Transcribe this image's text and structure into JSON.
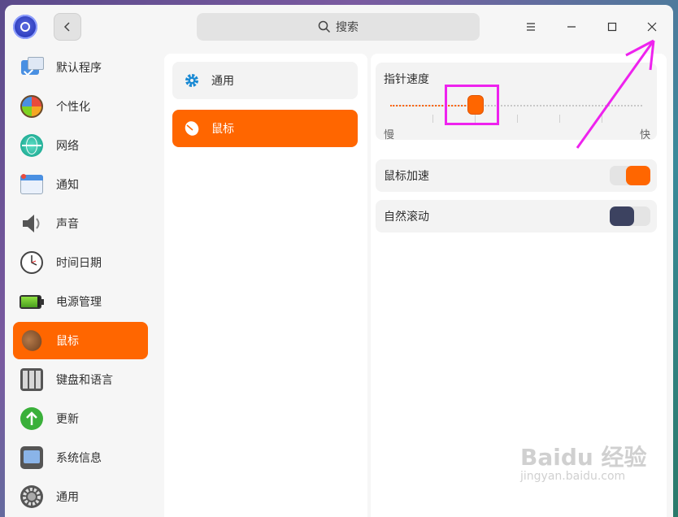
{
  "search": {
    "label": "搜索"
  },
  "titlebar": {
    "menu_icon": "menu-icon",
    "minimize_icon": "minimize-icon",
    "maximize_icon": "maximize-icon",
    "close_icon": "close-icon"
  },
  "sidebar": {
    "items": [
      {
        "label": "默认程序",
        "icon": "default-apps-icon"
      },
      {
        "label": "个性化",
        "icon": "personalization-icon"
      },
      {
        "label": "网络",
        "icon": "network-icon"
      },
      {
        "label": "通知",
        "icon": "notification-icon"
      },
      {
        "label": "声音",
        "icon": "sound-icon"
      },
      {
        "label": "时间日期",
        "icon": "clock-icon"
      },
      {
        "label": "电源管理",
        "icon": "battery-icon"
      },
      {
        "label": "鼠标",
        "icon": "mouse-icon",
        "active": true
      },
      {
        "label": "键盘和语言",
        "icon": "keyboard-icon"
      },
      {
        "label": "更新",
        "icon": "update-icon"
      },
      {
        "label": "系统信息",
        "icon": "system-info-icon"
      },
      {
        "label": "通用",
        "icon": "general-icon"
      }
    ]
  },
  "submenu": {
    "general": "通用",
    "mouse": "鼠标"
  },
  "mouse_settings": {
    "pointer_speed": {
      "label": "指针速度",
      "slow": "慢",
      "fast": "快",
      "value": 0.34
    },
    "mouse_acceleration": {
      "label": "鼠标加速",
      "on": true
    },
    "natural_scrolling": {
      "label": "自然滚动",
      "on": false
    }
  },
  "colors": {
    "accent": "#ff6600",
    "toggle_off_knob": "#3c4260",
    "annotation": "#ee22ee"
  },
  "watermark": {
    "brand": "Baidu 经验",
    "url": "jingyan.baidu.com"
  }
}
